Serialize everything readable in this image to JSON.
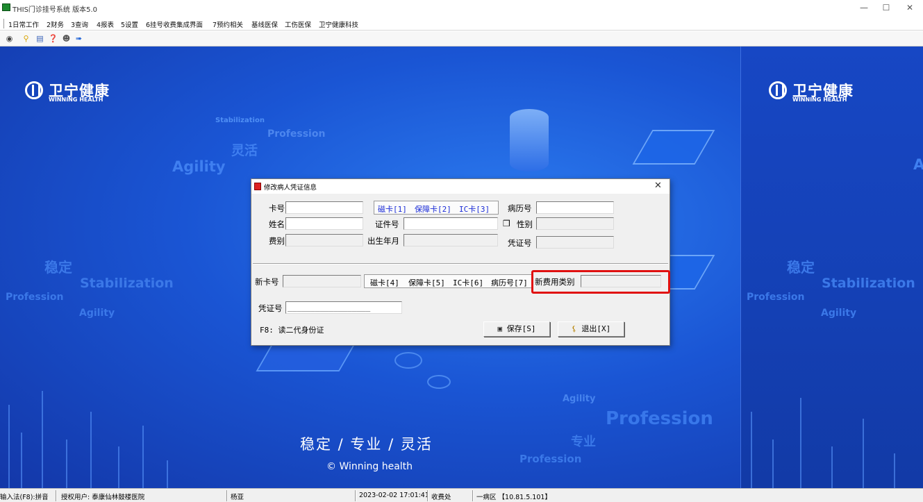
{
  "window": {
    "title": "THIS门诊挂号系统 版本5.0",
    "controls": [
      "—",
      "☐",
      "✕"
    ]
  },
  "menu": {
    "items": [
      "1日常工作",
      "2财务",
      "3查询",
      "4报表",
      "5设置",
      "6挂号收费集成界面",
      "7预约相关",
      "基线医保",
      "工伤医保",
      "卫宁健康科技"
    ]
  },
  "toolbar": {
    "icons": [
      "lock-icon",
      "key-icon",
      "print-icon",
      "help-icon",
      "user-icon",
      "exit-icon"
    ]
  },
  "background": {
    "brand_cn": "卫宁健康",
    "brand_en": "WINNING HEALTH",
    "deco_words": {
      "stabilization": "Stabilization",
      "profession": "Profession",
      "agility": "Agility",
      "linghuo": "灵活",
      "wending": "稳定",
      "zhuanye": "专业",
      "a_letter": "A"
    },
    "tagline": "稳定 / 专业 / 灵活",
    "copyright": "© Winning health",
    "colors": {
      "primary": "#1a55d4",
      "accent": "#6aa8ff"
    }
  },
  "dialog": {
    "title": "修改病人凭证信息",
    "close": "✕",
    "fields": {
      "card_no": {
        "label": "卡号",
        "value": ""
      },
      "name": {
        "label": "姓名",
        "value": ""
      },
      "fee_type": {
        "label": "费别",
        "value": ""
      },
      "id_no": {
        "label": "证件号",
        "value": ""
      },
      "birth": {
        "label": "出生年月",
        "value": ""
      },
      "record_no": {
        "label": "病历号",
        "value": ""
      },
      "gender": {
        "label": "性别",
        "value": ""
      },
      "voucher_no": {
        "label": "凭证号",
        "value": ""
      },
      "new_card_no": {
        "label": "新卡号",
        "value": ""
      },
      "new_fee_type": {
        "label": "新费用类别",
        "value": ""
      },
      "voucher_no2": {
        "label": "凭证号",
        "value": "__________________"
      }
    },
    "card_tabs_top": [
      "磁卡[1]",
      "保障卡[2]",
      "IC卡[3]"
    ],
    "card_tabs_bottom": [
      "磁卡[4]",
      "保障卡[5]",
      "IC卡[6]",
      "病历号[7]"
    ],
    "hint": "F8: 读二代身份证",
    "save_label": "保存[S]",
    "exit_label": "退出[X]"
  },
  "statusbar": {
    "input_method": "输入法(F8):拼音",
    "auth_user": "授权用户: 泰康仙林鼓楼医院",
    "operator": "杨亚",
    "datetime": "2023-02-02 17:01:41",
    "window_name": "收费处",
    "ward": "一病区 【10.81.5.101】"
  }
}
